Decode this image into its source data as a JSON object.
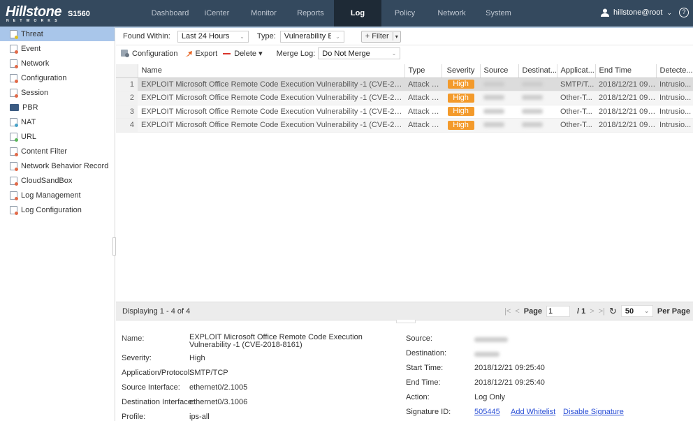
{
  "app": {
    "brand": "Hillstone",
    "brand_sub": "NETWORKS",
    "model": "S1560"
  },
  "nav": [
    {
      "label": "Dashboard"
    },
    {
      "label": "iCenter"
    },
    {
      "label": "Monitor"
    },
    {
      "label": "Reports"
    },
    {
      "label": "Log",
      "active": true
    },
    {
      "label": "Policy"
    },
    {
      "label": "Network"
    },
    {
      "label": "System"
    }
  ],
  "user": {
    "name": "hillstone@root",
    "icon": "user-icon",
    "help_icon": "?"
  },
  "sidebar": [
    {
      "label": "Threat",
      "active": true,
      "dot": "#e0c020"
    },
    {
      "label": "Event",
      "dot": "#e26b4a"
    },
    {
      "label": "Network",
      "dot": "#e26b4a"
    },
    {
      "label": "Configuration",
      "dot": "#e26b4a"
    },
    {
      "label": "Session",
      "dot": "#e26b4a"
    },
    {
      "label": "PBR",
      "dot": ""
    },
    {
      "label": "NAT",
      "dot": "#4aa3c8"
    },
    {
      "label": "URL",
      "dot": "#5cb85c"
    },
    {
      "label": "Content Filter",
      "dot": "#e26b4a"
    },
    {
      "label": "Network Behavior Record",
      "dot": "#e26b4a"
    },
    {
      "label": "CloudSandBox",
      "dot": "#e26b4a"
    },
    {
      "label": "Log Management",
      "dot": "#e26b4a"
    },
    {
      "label": "Log Configuration",
      "dot": "#e26b4a"
    }
  ],
  "filters": {
    "found_within_label": "Found Within:",
    "found_within_value": "Last 24 Hours",
    "type_label": "Type:",
    "type_value": "Vulnerability Exploi",
    "filter_button": "+ Filter",
    "filter_caret": "▾"
  },
  "toolbar": {
    "configuration": "Configuration",
    "export": "Export",
    "delete": "Delete ▾",
    "merge_label": "Merge Log:",
    "merge_value": "Do Not Merge"
  },
  "table": {
    "columns": [
      "",
      "Name",
      "Type",
      "Severity",
      "Source",
      "Destinat...",
      "Applicat...",
      "End Time",
      "Detecte..."
    ],
    "rows": [
      {
        "n": "1",
        "name": "EXPLOIT Microsoft Office Remote Code Execution Vulnerability -1 (CVE-2018-8161)",
        "type": "Attack - ...",
        "severity": "High",
        "app": "SMTP/T...",
        "end": "2018/12/21 09:2...",
        "detected": "Intrusio..."
      },
      {
        "n": "2",
        "name": "EXPLOIT Microsoft Office Remote Code Execution Vulnerability -1 (CVE-2018-8161)",
        "type": "Attack - ...",
        "severity": "High",
        "app": "Other-T...",
        "end": "2018/12/21 09:2...",
        "detected": "Intrusio..."
      },
      {
        "n": "3",
        "name": "EXPLOIT Microsoft Office Remote Code Execution Vulnerability -1 (CVE-2018-8161)",
        "type": "Attack - ...",
        "severity": "High",
        "app": "Other-T...",
        "end": "2018/12/21 09:2...",
        "detected": "Intrusio..."
      },
      {
        "n": "4",
        "name": "EXPLOIT Microsoft Office Remote Code Execution Vulnerability -1 (CVE-2018-8161)",
        "type": "Attack - ...",
        "severity": "High",
        "app": "Other-T...",
        "end": "2018/12/21 09:2...",
        "detected": "Intrusio..."
      }
    ],
    "severity_color": "#f39a2b"
  },
  "pager": {
    "display": "Displaying 1 - 4 of 4",
    "page_label": "Page",
    "page_value": "1",
    "of": "/ 1",
    "per_page_value": "50",
    "per_page_label": "Per Page"
  },
  "detail": {
    "left": [
      {
        "label": "Name:",
        "value": "EXPLOIT Microsoft Office Remote Code Execution Vulnerability -1 (CVE-2018-8161)"
      },
      {
        "label": "Severity:",
        "value": "High"
      },
      {
        "label": "Application/Protocol:",
        "value": "SMTP/TCP"
      },
      {
        "label": "Source Interface:",
        "value": "ethernet0/2.1005"
      },
      {
        "label": "Destination Interface:",
        "value": "ethernet0/3.1006"
      },
      {
        "label": "Profile:",
        "value": "ips-all"
      }
    ],
    "right": [
      {
        "label": "Source:",
        "value": ""
      },
      {
        "label": "Destination:",
        "value": ""
      },
      {
        "label": "Start Time:",
        "value": "2018/12/21 09:25:40"
      },
      {
        "label": "End Time:",
        "value": "2018/12/21 09:25:40"
      },
      {
        "label": "Action:",
        "value": "Log Only"
      },
      {
        "label": "Signature ID:",
        "value": "505445"
      }
    ],
    "add_whitelist": "Add Whitelist",
    "disable_signature": "Disable Signature"
  }
}
